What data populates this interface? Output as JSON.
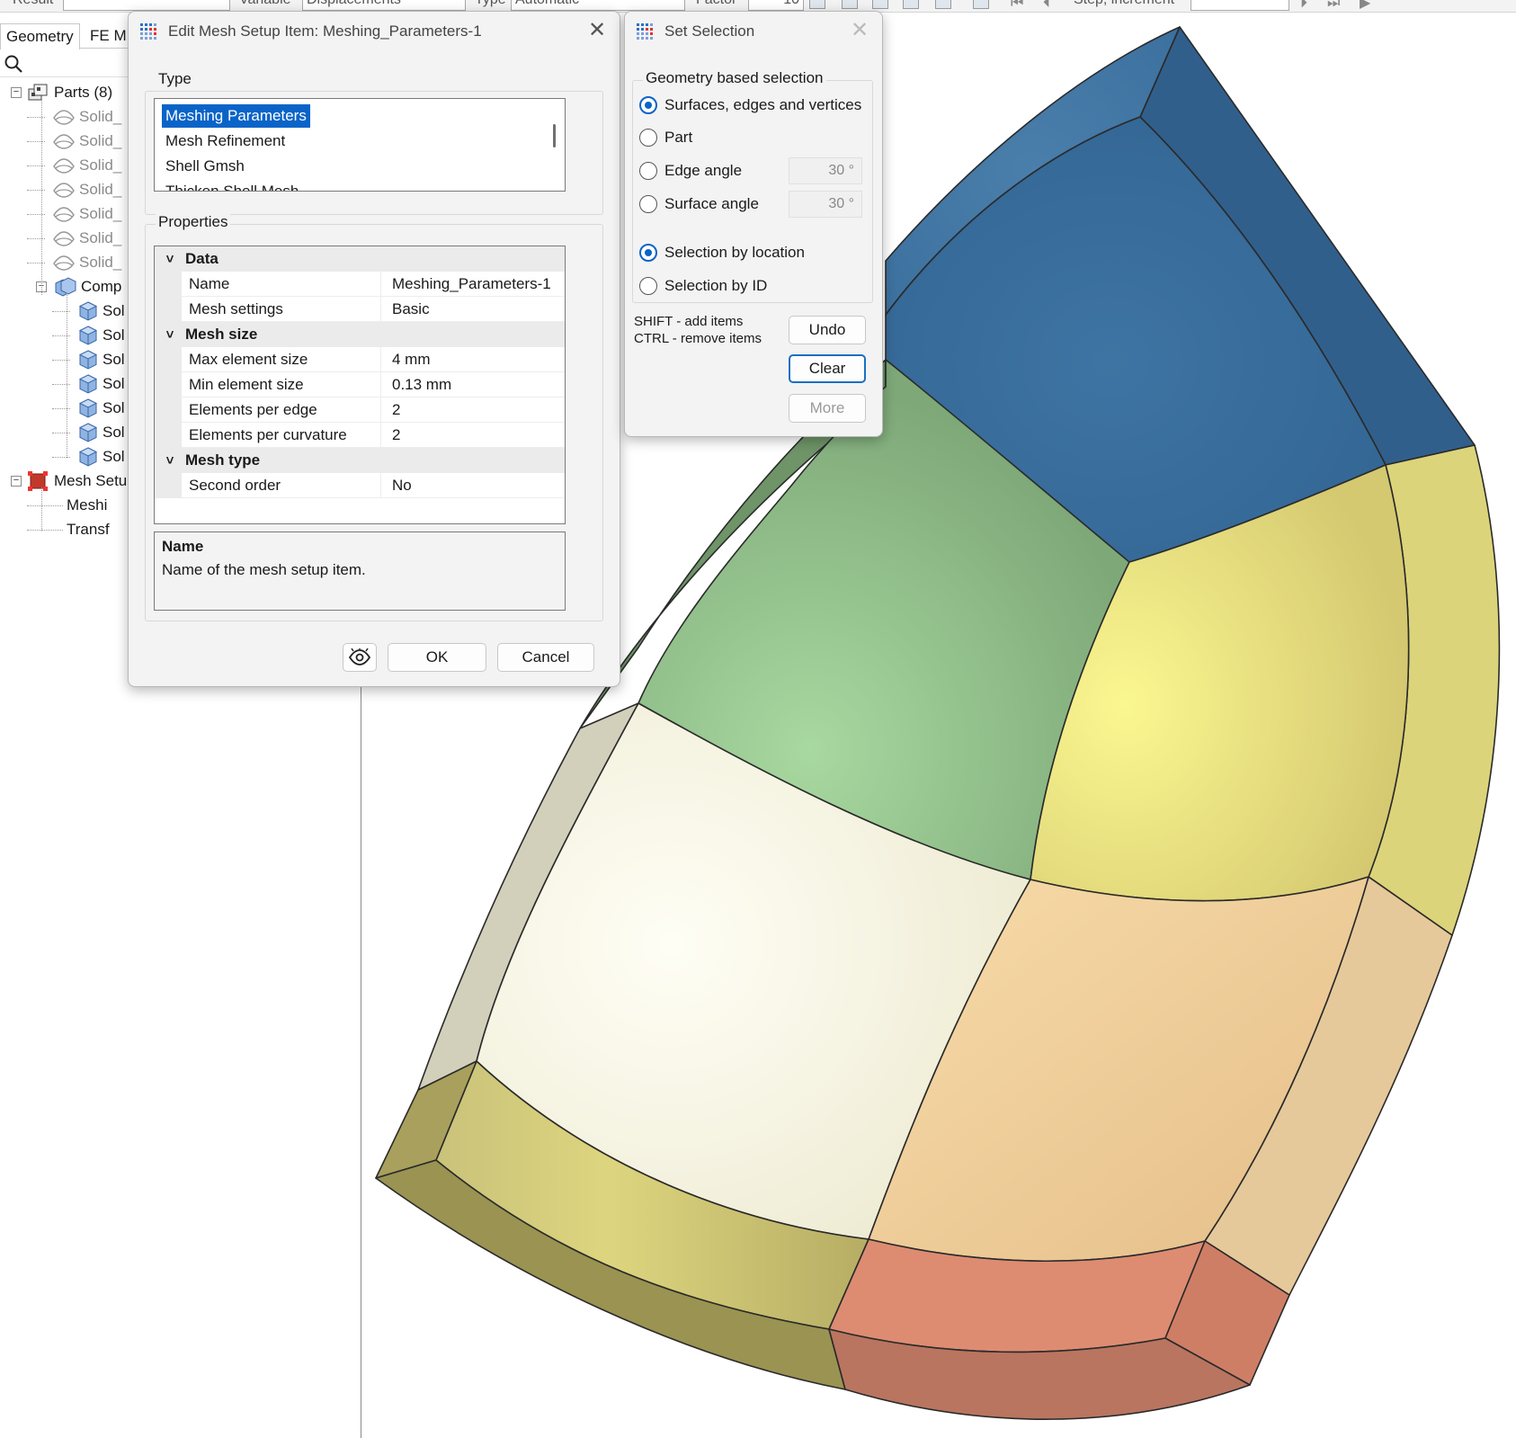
{
  "toolbar": {
    "result_label": "Result",
    "variable_label": "Variable",
    "variable_value": "Displacements",
    "type_label": "Type",
    "type_value": "Automatic",
    "factor_label": "Factor",
    "factor_value": "10",
    "step_label": "Step, increment"
  },
  "left_panel": {
    "tabs": [
      "Geometry",
      "FE M"
    ],
    "tree": {
      "parts_label": "Parts (8)",
      "solids": [
        "Solid_",
        "Solid_",
        "Solid_",
        "Solid_",
        "Solid_",
        "Solid_",
        "Solid_"
      ],
      "compound_label": "Comp",
      "compound_children": [
        "Sol",
        "Sol",
        "Sol",
        "Sol",
        "Sol",
        "Sol",
        "Sol"
      ],
      "mesh_setup_label": "Mesh Setu",
      "mesh_setup_children": [
        "Meshi",
        "Transf"
      ]
    }
  },
  "edit_dialog": {
    "title": "Edit Mesh Setup Item: Meshing_Parameters-1",
    "type_group_label": "Type",
    "type_items": [
      "Meshing Parameters",
      "Mesh Refinement",
      "Shell Gmsh",
      "Thicken Shell Mesh"
    ],
    "properties_group_label": "Properties",
    "categories": {
      "data": "Data",
      "mesh_size": "Mesh size",
      "mesh_type": "Mesh type"
    },
    "properties": {
      "name": {
        "label": "Name",
        "value": "Meshing_Parameters-1"
      },
      "mesh_settings": {
        "label": "Mesh settings",
        "value": "Basic"
      },
      "max_element_size": {
        "label": "Max element size",
        "value": "4 mm"
      },
      "min_element_size": {
        "label": "Min element size",
        "value": "0.13 mm"
      },
      "elements_per_edge": {
        "label": "Elements per edge",
        "value": "2"
      },
      "elements_per_curvature": {
        "label": "Elements per curvature",
        "value": "2"
      },
      "second_order": {
        "label": "Second order",
        "value": "No"
      }
    },
    "description": {
      "title": "Name",
      "text": "Name of the mesh setup item."
    },
    "ok_label": "OK",
    "cancel_label": "Cancel"
  },
  "set_selection": {
    "title": "Set Selection",
    "group_label": "Geometry based selection",
    "options": {
      "surfaces": "Surfaces, edges and vertices",
      "part": "Part",
      "edge_angle": "Edge angle",
      "surface_angle": "Surface angle",
      "by_location": "Selection by location",
      "by_id": "Selection by ID"
    },
    "edge_angle_value": "30 °",
    "surface_angle_value": "30 °",
    "hint_shift": "SHIFT - add items",
    "hint_ctrl": "CTRL - remove items",
    "undo_label": "Undo",
    "clear_label": "Clear",
    "more_label": "More"
  },
  "colors": {
    "selection_blue": "#0a64c8",
    "face_blue": "#3b6f9b",
    "face_green": "#86b482",
    "face_yellow": "#e4dc78",
    "face_cream": "#f3f1d8",
    "face_peach": "#f2cf9c",
    "face_salmon": "#d98b70",
    "face_olive": "#c8c070",
    "face_grey": "#d3d1bd"
  }
}
